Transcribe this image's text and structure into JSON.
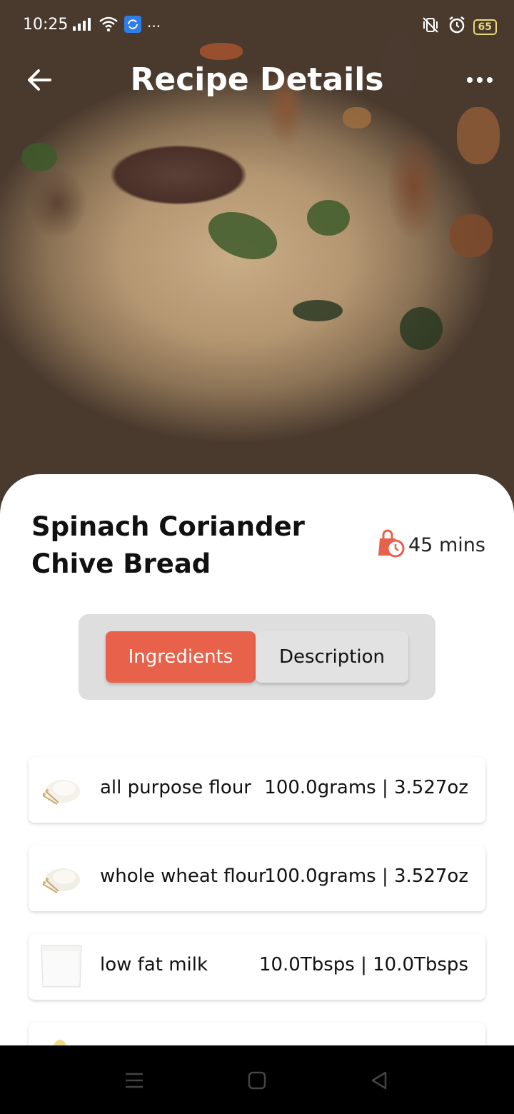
{
  "status_bar": {
    "time": "10:25",
    "battery": "65",
    "icons": [
      "signal-icon",
      "wifi-icon",
      "sync-app-icon",
      "more-dots-icon",
      "vibrate-icon",
      "alarm-icon",
      "battery-icon"
    ]
  },
  "app_bar": {
    "title": "Recipe Details",
    "back_icon": "back-arrow-icon",
    "menu_icon": "more-vert-icon"
  },
  "recipe": {
    "title": "Spinach Coriander Chive Bread",
    "time": "45 mins",
    "time_icon": "timer-bag-icon"
  },
  "tabs": {
    "ingredients": "Ingredients",
    "description": "Description",
    "active": "ingredients"
  },
  "ingredients": [
    {
      "name": "all purpose flour",
      "quantity": "100.0grams | 3.527oz",
      "icon": "flour-icon"
    },
    {
      "name": "whole wheat flour",
      "quantity": "100.0grams | 3.527oz",
      "icon": "flour-icon"
    },
    {
      "name": "low fat milk",
      "quantity": "10.0Tbsps | 10.0Tbsps",
      "icon": "milk-glass-icon"
    }
  ],
  "colors": {
    "accent": "#e8614a",
    "tab_container": "#dedede",
    "sheet": "#ffffff"
  },
  "nav_bar": {
    "icons": [
      "recents-icon",
      "home-icon",
      "back-triangle-icon"
    ]
  }
}
